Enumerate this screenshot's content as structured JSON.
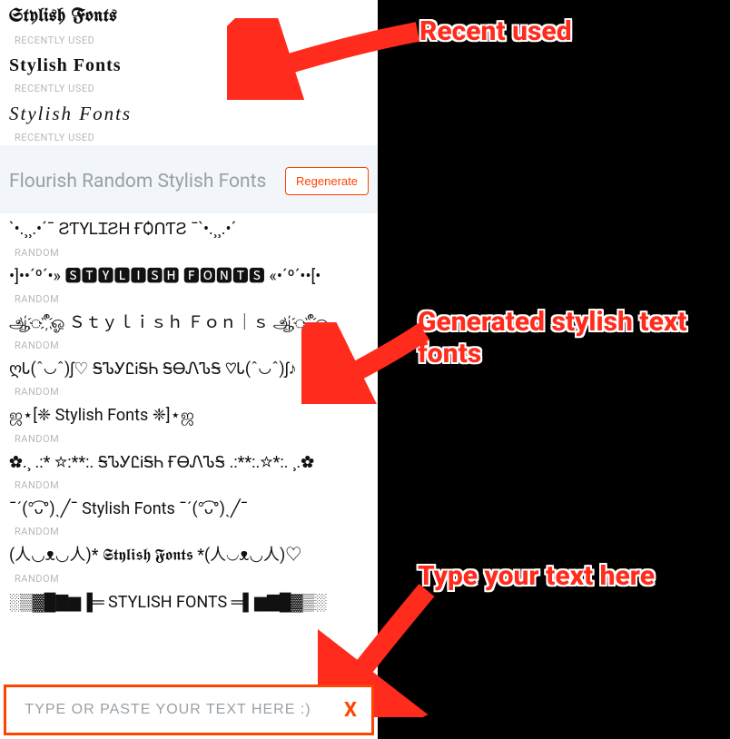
{
  "recent": {
    "meta_label": "RECENTLY USED",
    "items": [
      {
        "text": "Stylish Fonts",
        "style": "sample-blackletter"
      },
      {
        "text": "Stylish Fonts",
        "style": "sample-serif"
      },
      {
        "text": "Stylish Fonts",
        "style": "sample-script"
      }
    ]
  },
  "flourish": {
    "title": "Flourish Random Stylish Fonts",
    "regenerate_label": "Regenerate",
    "meta_label": "RANDOM",
    "items": [
      "`•.¸¸.•´¯ ƧƬYᏞꞮƧH ҒѺᑎƬƧ ¯`•.¸¸.•´",
      "•]••´º´•» 🆂🆃🆈🅻🅸🆂🅷 🅵🅾🅽🆃🆂 «•´º´••[•",
      "ஆ҉ீ҉ஓ Ｓｔｙｌｉｓｈ Ｆｏｎ｜ｓ ஆ҉ீ҉ஓ",
      "ღᏓ(ˆ◡ˆ)ʃ♡ ᎦᏖᎩᏝᎥᎦᏂ ᎦᎾᏁᏖᎦ ♡Ꮣ(ˆ◡ˆ)ʃ♪",
      "ஜ⋆[❈ Stylish Fonts ❈]⋆ஜ",
      "✿.¸ .:* ☆:**:. ᎦᏖᎩᏝᎥᎦᏂ ҒᎾᏁᏖᎦ .:**:.☆*:. ¸.✿",
      "¯ˊ(°͡ᴗ°)ˎ╱¯ Stylish Fonts ¯ˊ(°͡ᴗ°)ˎ╱¯",
      "(人◡ᴥ◡人)* 𝕾𝖙𝖞𝖑𝖎𝖘𝖍 𝕱𝖔𝖓𝖙𝖘 *(人◡ᴥ◡人)♡",
      "░▒▓█▇▆▐═ STYLISH FONTS ═▌▆▇█▓▒░"
    ]
  },
  "input": {
    "placeholder": "TYPE OR PASTE YOUR TEXT HERE :)",
    "clear_label": "X"
  },
  "annotations": {
    "recent": "Recent used",
    "generated": "Generated stylish text fonts",
    "type": "Type your text here"
  }
}
